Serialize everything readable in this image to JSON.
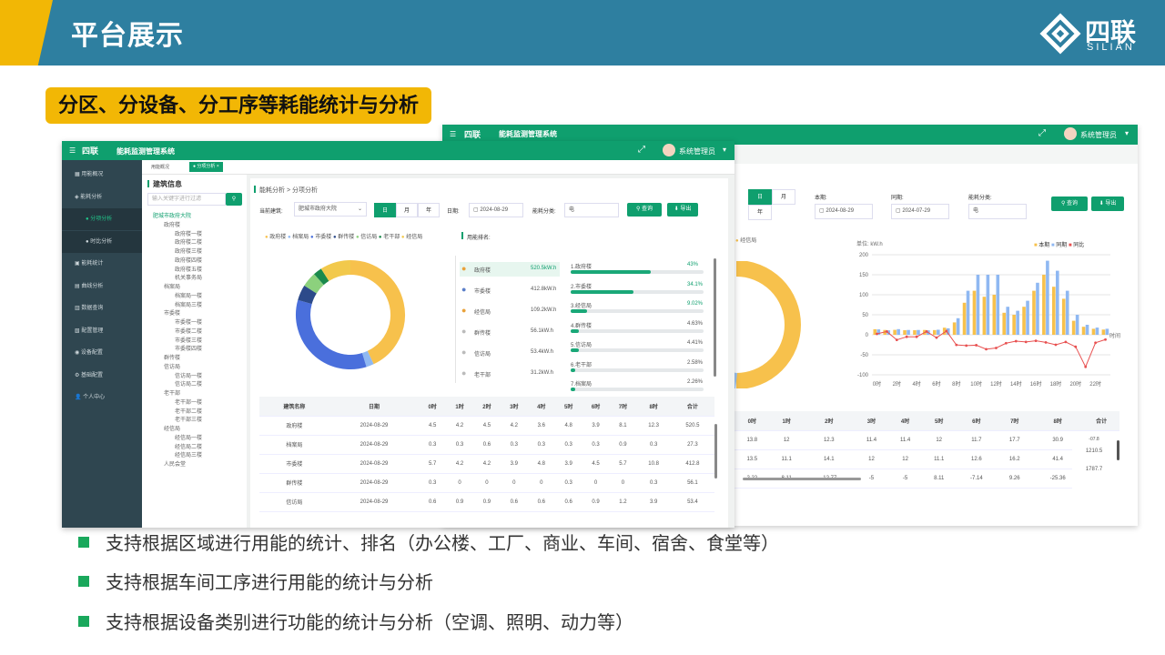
{
  "header": {
    "title": "平台展示",
    "logo_cn": "四联",
    "logo_en": "SILIAN"
  },
  "subtitle": "分区、分设备、分工序等耗能统计与分析",
  "bullets": [
    "支持根据区域进行用能的统计、排名（办公楼、工厂、商业、车间、宿舍、食堂等）",
    "支持根据车间工序进行用能的统计与分析",
    "支持根据设备类别进行功能的统计与分析（空调、照明、动力等）"
  ],
  "app": {
    "title": "能耗监测管理系统",
    "user": "系统管理员"
  },
  "sidebar": [
    "用能概况",
    "能耗分析",
    "分项分析",
    "时比分析",
    "能耗统计",
    "曲线分析",
    "数据查询",
    "配置管理",
    "设备配置",
    "基础配置",
    "个人中心"
  ],
  "tabs": [
    "用能概况",
    "分项分析"
  ],
  "tree": {
    "title": "建筑信息",
    "search_placeholder": "输入关键字进行过滤",
    "nodes": [
      "肥城市政府大院",
      "政府楼",
      "政府楼一楼",
      "政府楼二楼",
      "政府楼三楼",
      "政府楼四楼",
      "政府楼五楼",
      "机关事务局",
      "档案局",
      "档案局一楼",
      "档案局三楼",
      "市委楼",
      "市委楼一楼",
      "市委楼二楼",
      "市委楼三楼",
      "市委楼四楼",
      "群传楼",
      "信访局",
      "信访局一楼",
      "信访局二楼",
      "老干部",
      "老干部一楼",
      "老干部二楼",
      "老干部三楼",
      "经信局",
      "经信局一楼",
      "经信局二楼",
      "经信局三楼",
      "人民会堂"
    ]
  },
  "front": {
    "breadcrumb": "能耗分析 > 分项分析",
    "lbl_building": "当前建筑:",
    "building": "肥城市政府大院",
    "periods": [
      "日",
      "月",
      "年"
    ],
    "lbl_date": "日期:",
    "date": "2024-08-29",
    "lbl_type": "能耗分类:",
    "type": "电",
    "query": "查询",
    "export": "导出",
    "legend": [
      "政府楼",
      "档案局",
      "市委楼",
      "群传楼",
      "信访局",
      "老干部",
      "经信局"
    ],
    "ranking_title": "用能排名:",
    "ranking": [
      {
        "name": "政府楼",
        "val": "520.5kW.h"
      },
      {
        "name": "市委楼",
        "val": "412.8kW.h"
      },
      {
        "name": "经信局",
        "val": "109.2kW.h"
      },
      {
        "name": "群传楼",
        "val": "56.1kW.h"
      },
      {
        "name": "信访局",
        "val": "53.4kW.h"
      },
      {
        "name": "老干部",
        "val": "31.2kW.h"
      }
    ],
    "pct": [
      {
        "label": "1.政府楼",
        "pct": "43%",
        "v": 43
      },
      {
        "label": "2.市委楼",
        "pct": "34.1%",
        "v": 34.1
      },
      {
        "label": "3.经信局",
        "pct": "9.02%",
        "v": 9.02
      },
      {
        "label": "4.群传楼",
        "pct": "4.63%",
        "v": 4.63
      },
      {
        "label": "5.信访局",
        "pct": "4.41%",
        "v": 4.41
      },
      {
        "label": "6.老干部",
        "pct": "2.58%",
        "v": 2.58
      },
      {
        "label": "7.档案局",
        "pct": "2.26%",
        "v": 2.26
      }
    ],
    "table_head": [
      "建筑名称",
      "日期",
      "0时",
      "1时",
      "2时",
      "3时",
      "4时",
      "5时",
      "6时",
      "7时",
      "8时",
      "合计"
    ],
    "table_rows": [
      [
        "政府楼",
        "2024-08-29",
        "4.5",
        "4.2",
        "4.5",
        "4.2",
        "3.6",
        "4.8",
        "3.9",
        "8.1",
        "12.3",
        "520.5"
      ],
      [
        "档案局",
        "2024-08-29",
        "0.3",
        "0.3",
        "0.6",
        "0.3",
        "0.3",
        "0.3",
        "0.3",
        "0.9",
        "0.3",
        "27.3"
      ],
      [
        "市委楼",
        "2024-08-29",
        "5.7",
        "4.2",
        "4.2",
        "3.9",
        "4.8",
        "3.9",
        "4.5",
        "5.7",
        "10.8",
        "412.8"
      ],
      [
        "群传楼",
        "2024-08-29",
        "0.3",
        "0",
        "0",
        "0",
        "0",
        "0.3",
        "0",
        "0",
        "0.3",
        "56.1"
      ],
      [
        "信访局",
        "2024-08-29",
        "0.6",
        "0.9",
        "0.9",
        "0.6",
        "0.6",
        "0.6",
        "0.9",
        "1.2",
        "3.9",
        "53.4"
      ]
    ]
  },
  "back": {
    "periods": [
      "日",
      "月",
      "年"
    ],
    "lbl_this": "本期:",
    "this_date": "2024-08-29",
    "lbl_prev": "同期:",
    "prev_date": "2024-07-29",
    "lbl_type": "能耗分类:",
    "type": "电",
    "query": "查询",
    "export": "导出",
    "unit": "单位: kW.h",
    "legend": [
      "本期",
      "同期",
      "同比"
    ],
    "axis_label": "时间",
    "table_head": [
      "0时",
      "1时",
      "2时",
      "3时",
      "4时",
      "5时",
      "6时",
      "7时",
      "8时",
      "合计"
    ],
    "table_rows": [
      [
        "13.8",
        "12",
        "12.3",
        "11.4",
        "11.4",
        "12",
        "11.7",
        "17.7",
        "30.9",
        "1210.5"
      ],
      [
        "13.5",
        "11.1",
        "14.1",
        "12",
        "12",
        "11.1",
        "12.6",
        "16.2",
        "41.4",
        "1787.7"
      ],
      [
        "2.22",
        "8.11",
        "-12.77",
        "-5",
        "-5",
        "8.11",
        "-7.14",
        "9.26",
        "-25.36",
        ""
      ]
    ],
    "extra": "-07.8"
  },
  "chart_data": {
    "type": "bar",
    "ylim": [
      -100,
      200
    ],
    "categories": [
      "0时",
      "1时",
      "2时",
      "3时",
      "4时",
      "5时",
      "6时",
      "7时",
      "8时",
      "9时",
      "10时",
      "11时",
      "12时",
      "13时",
      "14时",
      "15时",
      "16时",
      "17时",
      "18时",
      "19时",
      "20时",
      "21时",
      "22时",
      "23时"
    ],
    "x_ticks": [
      "0时",
      "2时",
      "4时",
      "6时",
      "8时",
      "10时",
      "12时",
      "14时",
      "16时",
      "18时",
      "20时",
      "22时"
    ],
    "y_ticks": [
      200,
      150,
      100,
      50,
      0,
      -50,
      -100
    ],
    "series": [
      {
        "name": "本期",
        "values": [
          13.8,
          12,
          12.3,
          11.4,
          11.4,
          12,
          11.7,
          17.7,
          30.9,
          80,
          110,
          95,
          100,
          55,
          50,
          70,
          110,
          150,
          120,
          90,
          35,
          20,
          15,
          13
        ]
      },
      {
        "name": "同期",
        "values": [
          13.5,
          11.1,
          14.1,
          12,
          12,
          11.1,
          12.6,
          16.2,
          41.4,
          110,
          150,
          150,
          150,
          70,
          60,
          85,
          130,
          185,
          160,
          110,
          50,
          25,
          18,
          15
        ]
      },
      {
        "name": "同比",
        "values": [
          2.22,
          8.11,
          -12.77,
          -5,
          -5,
          8.11,
          -7.14,
          9.26,
          -25.36,
          -27,
          -26,
          -36,
          -33,
          -21,
          -16,
          -18,
          -15,
          -19,
          -25,
          -18,
          -30,
          -80,
          -20,
          -12
        ]
      }
    ]
  }
}
